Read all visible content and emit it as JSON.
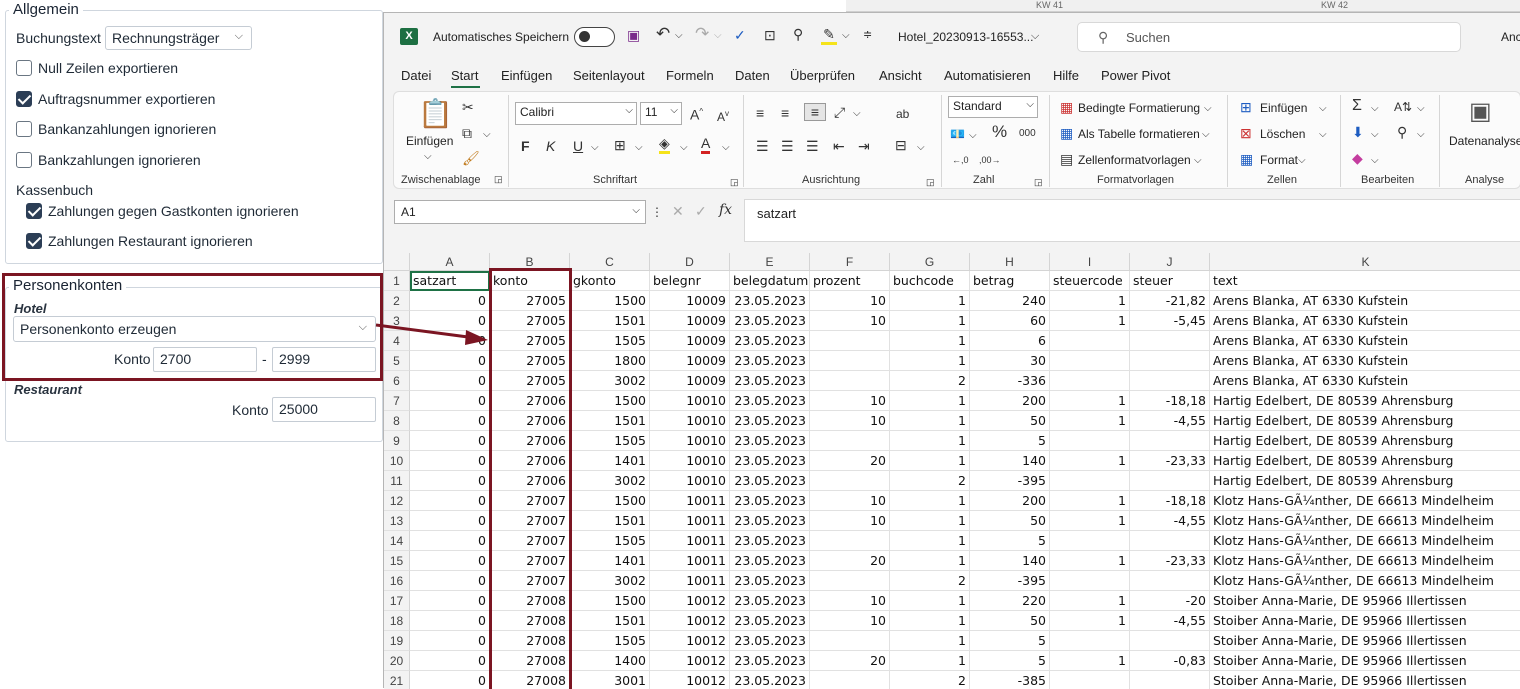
{
  "left_panel": {
    "allgemein": {
      "title": "Allgemein",
      "buchungstext_label": "Buchungstext",
      "buchungstext_value": "Rechnungsträger",
      "options": [
        {
          "label": "Null Zeilen exportieren",
          "checked": false
        },
        {
          "label": "Auftragsnummer exportieren",
          "checked": true
        },
        {
          "label": "Bankanzahlungen ignorieren",
          "checked": false
        },
        {
          "label": "Bankzahlungen ignorieren",
          "checked": false
        }
      ],
      "kassenbuch_title": "Kassenbuch",
      "kassenbuch_options": [
        {
          "label": "Zahlungen gegen Gastkonten ignorieren",
          "checked": true
        },
        {
          "label": "Zahlungen Restaurant ignorieren",
          "checked": true
        }
      ]
    },
    "personenkonten": {
      "title": "Personenkonten",
      "hotel_label": "Hotel",
      "hotel_select": "Personenkonto erzeugen",
      "konto_label": "Konto",
      "konto_from": "2700",
      "separator": "-",
      "konto_to": "2999",
      "restaurant_label": "Restaurant",
      "restaurant_konto_label": "Konto",
      "restaurant_konto_value": "25000"
    },
    "highlight_color": "#7b1522"
  },
  "background": {
    "kw41": "KW 41",
    "kw42": "KW 42"
  },
  "excel": {
    "autosave_label": "Automatisches Speichern",
    "filename": "Hotel_20230913-16553...",
    "search_placeholder": "Suchen",
    "user_trunc": "Anc",
    "tabs": [
      "Datei",
      "Start",
      "Einfügen",
      "Seitenlayout",
      "Formeln",
      "Daten",
      "Überprüfen",
      "Ansicht",
      "Automatisieren",
      "Hilfe",
      "Power Pivot"
    ],
    "active_tab": "Start",
    "ribbon": {
      "paste_label": "Einfügen",
      "font_name": "Calibri",
      "font_size": "11",
      "number_format": "Standard",
      "cond_format": "Bedingte Formatierung",
      "as_table": "Als Tabelle formatieren",
      "cell_styles": "Zellenformatvorlagen",
      "insert": "Einfügen",
      "delete": "Löschen",
      "format": "Format",
      "data_analysis": "Datenanalyse",
      "groups": [
        "Zwischenablage",
        "Schriftart",
        "Ausrichtung",
        "Zahl",
        "Formatvorlagen",
        "Zellen",
        "Bearbeiten",
        "Analyse"
      ]
    },
    "name_box": "A1",
    "formula": "satzart",
    "columns": [
      "A",
      "B",
      "C",
      "D",
      "E",
      "F",
      "G",
      "H",
      "I",
      "J",
      "K"
    ],
    "header_row": [
      "satzart",
      "konto",
      "gkonto",
      "belegnr",
      "belegdatum",
      "prozent",
      "buchcode",
      "betrag",
      "steuercode",
      "steuer",
      "text"
    ],
    "rows": [
      [
        "0",
        "27005",
        "1500",
        "10009",
        "23.05.2023",
        "10",
        "1",
        "240",
        "1",
        "-21,82",
        "Arens Blanka, AT 6330 Kufstein"
      ],
      [
        "0",
        "27005",
        "1501",
        "10009",
        "23.05.2023",
        "10",
        "1",
        "60",
        "1",
        "-5,45",
        "Arens Blanka, AT 6330 Kufstein"
      ],
      [
        "0",
        "27005",
        "1505",
        "10009",
        "23.05.2023",
        "",
        "1",
        "6",
        "",
        "",
        "Arens Blanka, AT 6330 Kufstein"
      ],
      [
        "0",
        "27005",
        "1800",
        "10009",
        "23.05.2023",
        "",
        "1",
        "30",
        "",
        "",
        "Arens Blanka, AT 6330 Kufstein"
      ],
      [
        "0",
        "27005",
        "3002",
        "10009",
        "23.05.2023",
        "",
        "2",
        "-336",
        "",
        "",
        "Arens Blanka, AT 6330 Kufstein"
      ],
      [
        "0",
        "27006",
        "1500",
        "10010",
        "23.05.2023",
        "10",
        "1",
        "200",
        "1",
        "-18,18",
        "Hartig Edelbert, DE 80539 Ahrensburg"
      ],
      [
        "0",
        "27006",
        "1501",
        "10010",
        "23.05.2023",
        "10",
        "1",
        "50",
        "1",
        "-4,55",
        "Hartig Edelbert, DE 80539 Ahrensburg"
      ],
      [
        "0",
        "27006",
        "1505",
        "10010",
        "23.05.2023",
        "",
        "1",
        "5",
        "",
        "",
        "Hartig Edelbert, DE 80539 Ahrensburg"
      ],
      [
        "0",
        "27006",
        "1401",
        "10010",
        "23.05.2023",
        "20",
        "1",
        "140",
        "1",
        "-23,33",
        "Hartig Edelbert, DE 80539 Ahrensburg"
      ],
      [
        "0",
        "27006",
        "3002",
        "10010",
        "23.05.2023",
        "",
        "2",
        "-395",
        "",
        "",
        "Hartig Edelbert, DE 80539 Ahrensburg"
      ],
      [
        "0",
        "27007",
        "1500",
        "10011",
        "23.05.2023",
        "10",
        "1",
        "200",
        "1",
        "-18,18",
        "Klotz Hans-GÃ¼nther, DE 66613 Mindelheim"
      ],
      [
        "0",
        "27007",
        "1501",
        "10011",
        "23.05.2023",
        "10",
        "1",
        "50",
        "1",
        "-4,55",
        "Klotz Hans-GÃ¼nther, DE 66613 Mindelheim"
      ],
      [
        "0",
        "27007",
        "1505",
        "10011",
        "23.05.2023",
        "",
        "1",
        "5",
        "",
        "",
        "Klotz Hans-GÃ¼nther, DE 66613 Mindelheim"
      ],
      [
        "0",
        "27007",
        "1401",
        "10011",
        "23.05.2023",
        "20",
        "1",
        "140",
        "1",
        "-23,33",
        "Klotz Hans-GÃ¼nther, DE 66613 Mindelheim"
      ],
      [
        "0",
        "27007",
        "3002",
        "10011",
        "23.05.2023",
        "",
        "2",
        "-395",
        "",
        "",
        "Klotz Hans-GÃ¼nther, DE 66613 Mindelheim"
      ],
      [
        "0",
        "27008",
        "1500",
        "10012",
        "23.05.2023",
        "10",
        "1",
        "220",
        "1",
        "-20",
        "Stoiber Anna-Marie, DE 95966 Illertissen"
      ],
      [
        "0",
        "27008",
        "1501",
        "10012",
        "23.05.2023",
        "10",
        "1",
        "50",
        "1",
        "-4,55",
        "Stoiber Anna-Marie, DE 95966 Illertissen"
      ],
      [
        "0",
        "27008",
        "1505",
        "10012",
        "23.05.2023",
        "",
        "1",
        "5",
        "",
        "",
        "Stoiber Anna-Marie, DE 95966 Illertissen"
      ],
      [
        "0",
        "27008",
        "1400",
        "10012",
        "23.05.2023",
        "20",
        "1",
        "5",
        "1",
        "-0,83",
        "Stoiber Anna-Marie, DE 95966 Illertissen"
      ],
      [
        "0",
        "27008",
        "3001",
        "10012",
        "23.05.2023",
        "",
        "2",
        "-385",
        "",
        "",
        "Stoiber Anna-Marie, DE 95966 Illertissen"
      ]
    ]
  }
}
